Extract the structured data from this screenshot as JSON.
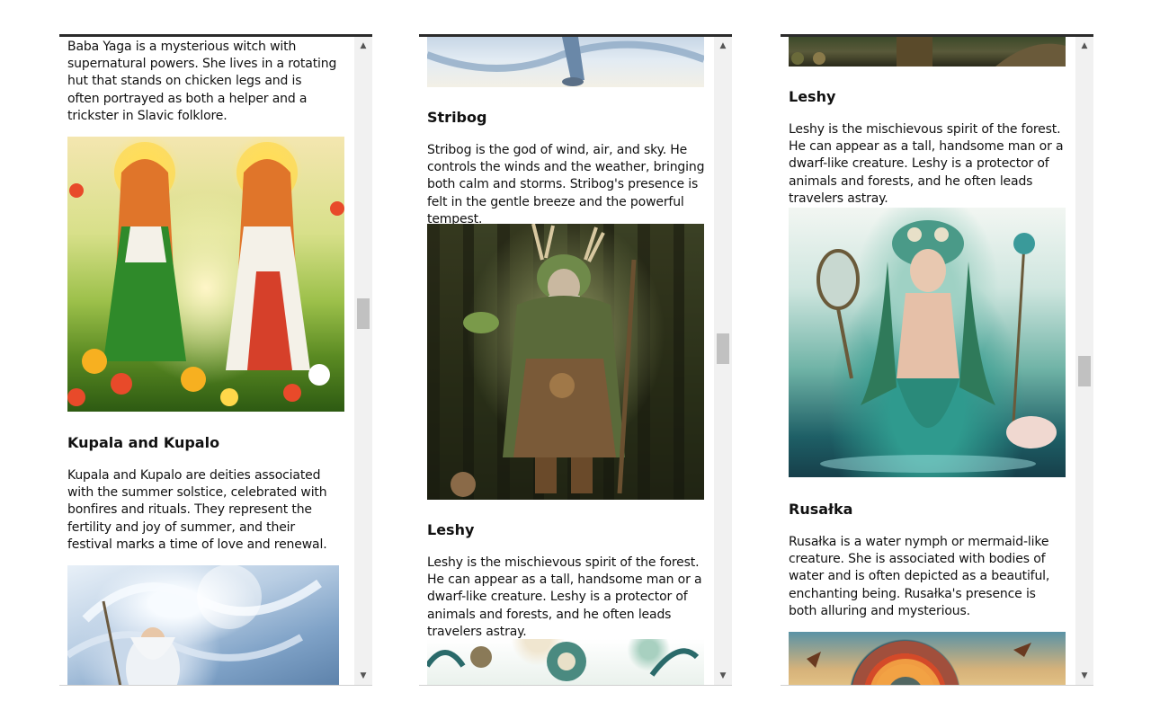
{
  "panels": [
    {
      "babayaga_tail": "Baba Yaga is a mysterious witch with supernatural powers. She lives in a rotating hut that stands on chicken legs and is often portrayed as both a helper and a trickster in Slavic folklore.",
      "kupala_heading": "Kupala and Kupalo",
      "kupala_text": "Kupala and Kupalo are deities associated with the summer solstice, celebrated with bonfires and rituals. They represent the fertility and joy of summer, and their festival marks a time of love and renewal.",
      "scroll_position": 0.42
    },
    {
      "stribog_heading": "Stribog",
      "stribog_text": "Stribog is the god of wind, air, and sky. He controls the winds and the weather, bringing both calm and storms. Stribog's presence is felt in the gentle breeze and the powerful tempest.",
      "leshy_heading": "Leshy",
      "leshy_text": "Leshy is the mischievous spirit of the forest. He can appear as a tall, handsome man or a dwarf-like creature. Leshy is a protector of animals and forests, and he often leads travelers astray.",
      "scroll_position": 0.5
    },
    {
      "leshy_heading": "Leshy",
      "leshy_text": "Leshy is the mischievous spirit of the forest. He can appear as a tall, handsome man or a dwarf-like creature. Leshy is a protector of animals and forests, and he often leads travelers astray.",
      "rusalka_heading": "Rusałka",
      "rusalka_text": "Rusałka is a water nymph or mermaid-like creature. She is associated with bodies of water and is often depicted as a beautiful, enchanting being. Rusałka's presence is both alluring and mysterious.",
      "scroll_position": 0.55
    }
  ],
  "scrollbar": {
    "up_icon": "▲",
    "down_icon": "▼"
  }
}
